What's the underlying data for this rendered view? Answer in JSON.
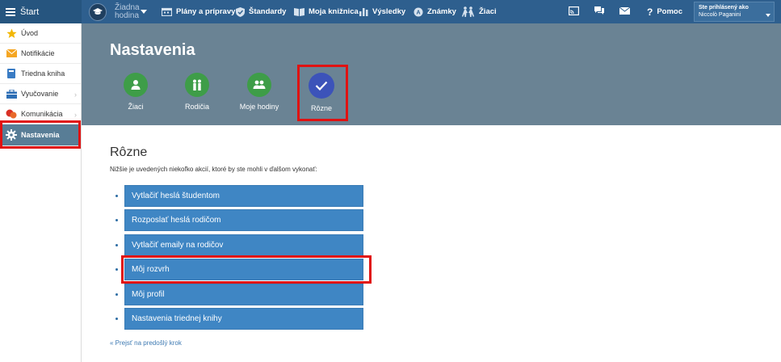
{
  "brand": {
    "label": "Štart"
  },
  "topbar": {
    "lesson_label": "Žiadna hodina",
    "nav": [
      {
        "label": "Plány a prípravy",
        "icon": "calendar-icon"
      },
      {
        "label": "Štandardy",
        "icon": "shield-icon"
      },
      {
        "label": "Moja knižnica",
        "icon": "library-icon"
      },
      {
        "label": "Výsledky",
        "icon": "bar-chart-icon"
      },
      {
        "label": "Známky",
        "icon": "grades-icon"
      },
      {
        "label": "Žiaci",
        "icon": "students-icon"
      }
    ],
    "help_label": "Pomoc",
    "user": {
      "caption": "Ste prihlásený ako",
      "name": "Niccolò Paganini"
    }
  },
  "sidebar": {
    "items": [
      {
        "label": "Úvod",
        "icon": "star-icon"
      },
      {
        "label": "Notifikácie",
        "icon": "envelope-icon"
      },
      {
        "label": "Triedna kniha",
        "icon": "book-icon"
      },
      {
        "label": "Vyučovanie",
        "icon": "briefcase-icon"
      },
      {
        "label": "Komunikácia",
        "icon": "chat-icon"
      },
      {
        "label": "Nastavenia",
        "icon": "gear-icon"
      }
    ]
  },
  "header": {
    "title": "Nastavenia",
    "tabs": [
      {
        "label": "Žiaci",
        "icon": "person-icon"
      },
      {
        "label": "Rodičia",
        "icon": "parents-icon"
      },
      {
        "label": "Moje hodiny",
        "icon": "group-icon"
      },
      {
        "label": "Rôzne",
        "icon": "check-icon"
      }
    ]
  },
  "main": {
    "title": "Rôzne",
    "description": "Nižšie je uvedených niekoľko akcií, ktoré by ste mohli v ďalšom vykonať:",
    "actions": [
      "Vytlačiť heslá študentom",
      "Rozposlať heslá rodičom",
      "Vytlačiť emaily na rodičov",
      "Môj rozvrh",
      "Môj profil",
      "Nastavenia triednej knihy"
    ],
    "back_link": "« Prejsť na predošlý krok"
  },
  "colors": {
    "topbar": "#2e5f8e",
    "header": "#6a8394",
    "action_button": "#3f86c4",
    "tab_green": "#3e9d48",
    "tab_selected": "#3c53b9",
    "highlight": "#e01212"
  }
}
